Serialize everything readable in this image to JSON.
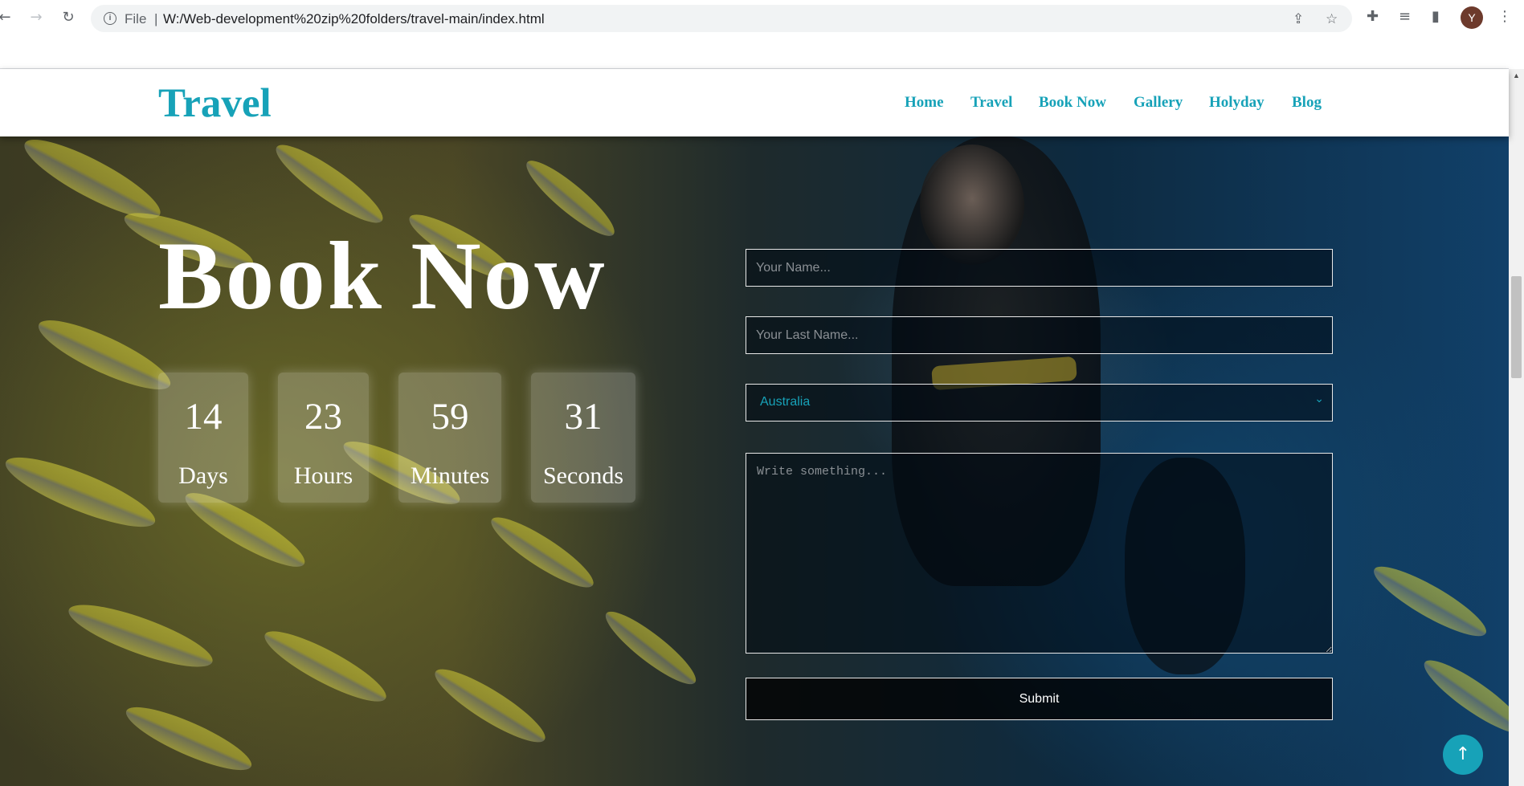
{
  "browser": {
    "back_icon": "←",
    "forward_icon": "→",
    "reload_icon": "↻",
    "scheme": "File",
    "separator": "|",
    "url": "W:/Web-development%20zip%20folders/travel-main/index.html",
    "share_icon": "⇪",
    "star_icon": "☆",
    "extensions_icon": "✚",
    "media_icon": "≡",
    "sidepanel_icon": "▮",
    "profile_initial": "Y",
    "menu_icon": "⋮"
  },
  "header": {
    "logo": "Travel",
    "nav": [
      "Home",
      "Travel",
      "Book Now",
      "Gallery",
      "Holyday",
      "Blog"
    ]
  },
  "hero": {
    "title": "Book Now",
    "countdown": [
      {
        "value": "14",
        "label": "Days"
      },
      {
        "value": "23",
        "label": "Hours"
      },
      {
        "value": "59",
        "label": "Minutes"
      },
      {
        "value": "31",
        "label": "Seconds"
      }
    ]
  },
  "form": {
    "first_name_placeholder": "Your Name...",
    "last_name_placeholder": "Your Last Name...",
    "country_value": "Australia",
    "message_placeholder": "Write something...",
    "submit_label": "Submit"
  },
  "colors": {
    "accent": "#17a2b8"
  },
  "scroll_top_icon": "↑"
}
